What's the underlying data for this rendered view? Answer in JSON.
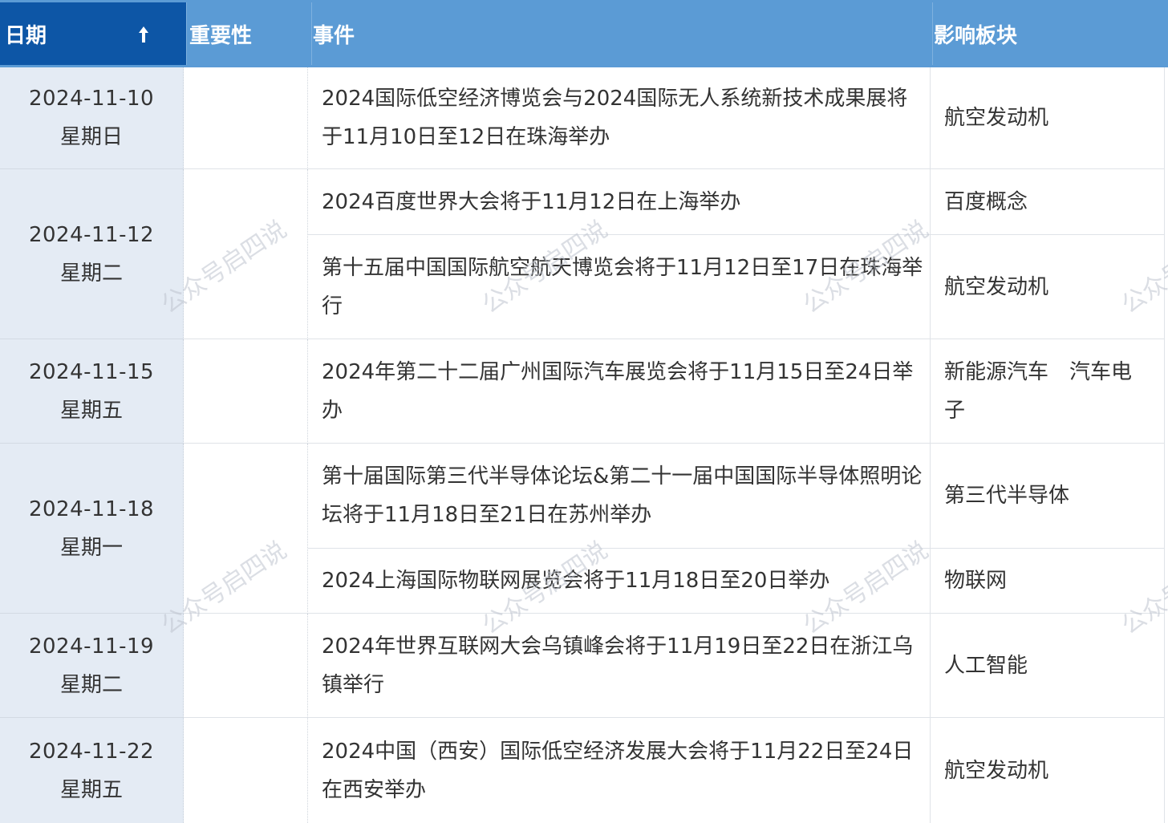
{
  "header": {
    "date": "日期",
    "importance": "重要性",
    "event": "事件",
    "sector": "影响板块"
  },
  "colors": {
    "header_bg": "#5b9bd5",
    "header_active_bg": "#0d56a6",
    "date_cell_bg": "#e4ebf4"
  },
  "rows": [
    {
      "date": "2024-11-10",
      "weekday": "星期日",
      "events": [
        {
          "text": "2024国际低空经济博览会与2024国际无人系统新技术成果展将于11月10日至12日在珠海举办",
          "sector": "航空发动机"
        }
      ]
    },
    {
      "date": "2024-11-12",
      "weekday": "星期二",
      "events": [
        {
          "text": "2024百度世界大会将于11月12日在上海举办",
          "sector": "百度概念"
        },
        {
          "text": "第十五届中国国际航空航天博览会将于11月12日至17日在珠海举行",
          "sector": "航空发动机"
        }
      ]
    },
    {
      "date": "2024-11-15",
      "weekday": "星期五",
      "events": [
        {
          "text": "2024年第二十二届广州国际汽车展览会将于11月15日至24日举办",
          "sector": "新能源汽车　汽车电子"
        }
      ]
    },
    {
      "date": "2024-11-18",
      "weekday": "星期一",
      "events": [
        {
          "text": "第十届国际第三代半导体论坛&第二十一届中国国际半导体照明论坛将于11月18日至21日在苏州举办",
          "sector": "第三代半导体"
        },
        {
          "text": "2024上海国际物联网展览会将于11月18日至20日举办",
          "sector": "物联网"
        }
      ]
    },
    {
      "date": "2024-11-19",
      "weekday": "星期二",
      "events": [
        {
          "text": "2024年世界互联网大会乌镇峰会将于11月19日至22日在浙江乌镇举行",
          "sector": "人工智能"
        }
      ]
    },
    {
      "date": "2024-11-22",
      "weekday": "星期五",
      "events": [
        {
          "text": "2024中国（西安）国际低空经济发展大会将于11月22日至24日在西安举办",
          "sector": "航空发动机"
        }
      ]
    }
  ],
  "watermark": "公众号启四说"
}
